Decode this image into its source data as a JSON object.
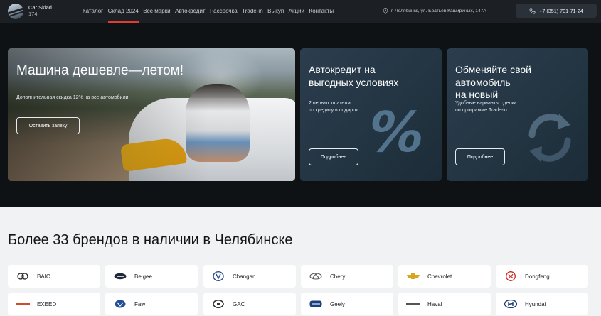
{
  "header": {
    "logo_name": "Car Sklad",
    "logo_number": "174",
    "nav": [
      "Каталог",
      "Склад 2024",
      "Все марки",
      "Автокредит",
      "Рассрочка",
      "Trade-in",
      "Выкуп",
      "Акции",
      "Контакты"
    ],
    "active_nav": "Склад 2024",
    "address": "г. Челябинск, ул. Братьев Кашириных, 147А",
    "phone": "+7 (351) 701-71-24"
  },
  "hero": {
    "main": {
      "title": "Машина дешевле—летом!",
      "text": "Дополнительная скидка 12%  на все автомобили",
      "button": "Оставить заявку"
    },
    "credit": {
      "title_line1": "Автокредит на",
      "title_line2": "выгодных условиях",
      "text_line1": "2 первых платежа",
      "text_line2": "по кредиту в подарок",
      "glyph": "%",
      "button": "Подробнее"
    },
    "trade": {
      "title_line1": "Обменяйте свой",
      "title_line2": "автомобиль",
      "title_line3": "на новый",
      "text_line1": "Удобные варианты сделки",
      "text_line2": "по программе Trade-in",
      "button": "Подробнее"
    }
  },
  "brands": {
    "title": "Более 33 брендов в наличии в Челябинске",
    "items": [
      {
        "name": "BAIC",
        "icon": "baic-logo"
      },
      {
        "name": "Belgee",
        "icon": "belgee-logo"
      },
      {
        "name": "Changan",
        "icon": "changan-logo"
      },
      {
        "name": "Chery",
        "icon": "chery-logo"
      },
      {
        "name": "Chevrolet",
        "icon": "chevrolet-logo"
      },
      {
        "name": "Dongfeng",
        "icon": "dongfeng-logo"
      },
      {
        "name": "EXEED",
        "icon": "exeed-logo"
      },
      {
        "name": "Faw",
        "icon": "faw-logo"
      },
      {
        "name": "GAC",
        "icon": "gac-logo"
      },
      {
        "name": "Geely",
        "icon": "geely-logo"
      },
      {
        "name": "Haval",
        "icon": "haval-logo"
      },
      {
        "name": "Hyundai",
        "icon": "hyundai-logo"
      }
    ]
  },
  "colors": {
    "header_bg": "#1c2024",
    "hero_bg": "#0f1215",
    "accent": "#e33b2e",
    "card_blue": "#243644"
  }
}
